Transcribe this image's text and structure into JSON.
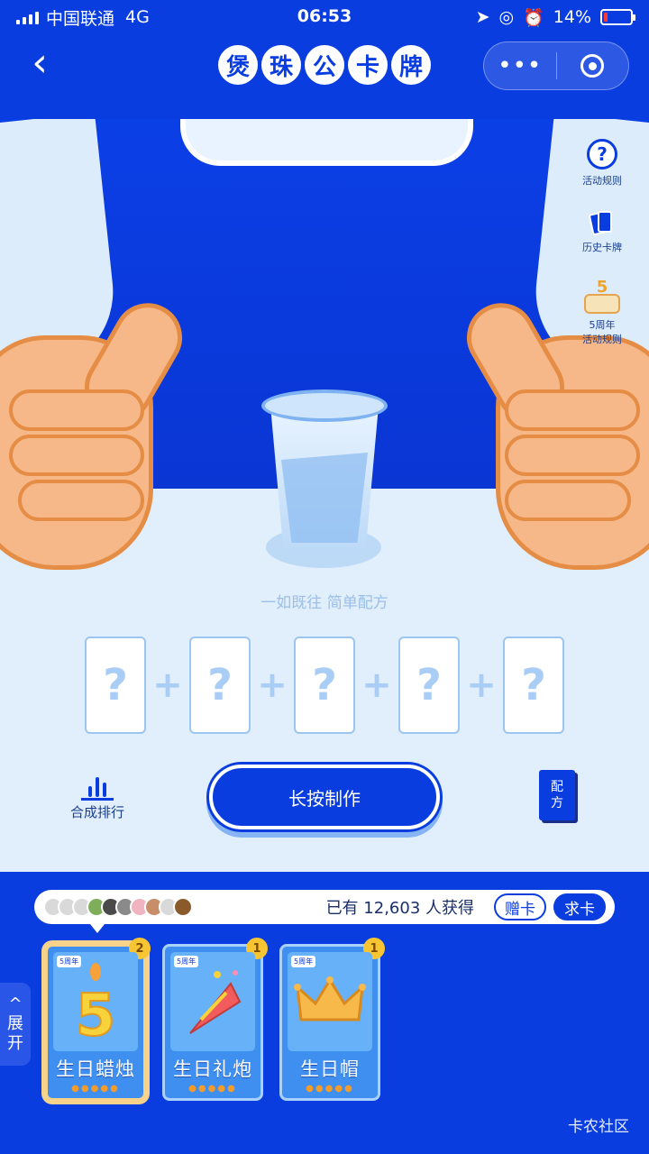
{
  "status": {
    "carrier": "中国联通",
    "network": "4G",
    "time": "06:53",
    "battery": "14%",
    "battery_level": 0.14
  },
  "nav": {
    "back_icon": "chevron-left-icon",
    "title_chars": [
      "煲",
      "珠",
      "公",
      "卡",
      "牌"
    ],
    "more_label": "•••",
    "capsule_icon": "target-icon"
  },
  "side_menu": {
    "rules": "活动规则",
    "history": "历史卡牌",
    "anniversary_line1": "5周年",
    "anniversary_line2": "活动规则",
    "anniversary_number": "5"
  },
  "scene": {
    "hint": "一如既往 简单配方",
    "slot_mark": "?",
    "plus_mark": "+"
  },
  "actions": {
    "rank_label": "合成排行",
    "make_label": "长按制作",
    "recipe_line1": "配",
    "recipe_line2": "方"
  },
  "panel": {
    "gets_text": "已有 12,603 人获得",
    "give_label": "赠卡",
    "ask_label": "求卡",
    "expand_line1": "^",
    "expand_line2": "展",
    "expand_line3": "开",
    "watermark": "卡农社区",
    "cards": [
      {
        "name": "生日蜡烛",
        "count": "2",
        "tag": "5周年",
        "drops": "●●●●●",
        "icon": "candle-five-icon"
      },
      {
        "name": "生日礼炮",
        "count": "1",
        "tag": "5周年",
        "drops": "●●●●●",
        "icon": "party-popper-icon"
      },
      {
        "name": "生日帽",
        "count": "1",
        "tag": "5周年",
        "drops": "●●●●●",
        "icon": "crown-hat-icon"
      }
    ]
  },
  "colors": {
    "brand_blue": "#0a3de0",
    "light_bg": "#e3f0fb",
    "badge_yellow": "#f7c531"
  }
}
